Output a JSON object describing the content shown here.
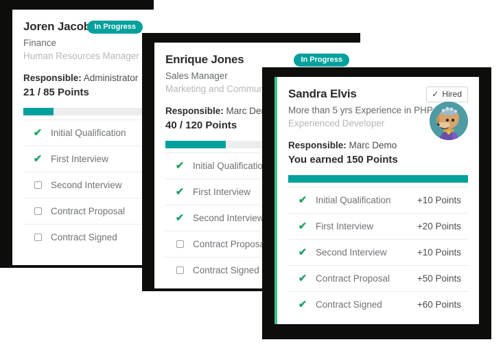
{
  "theme": {
    "teal": "#00a09d",
    "green_accent": "#41c08b",
    "check_green": "#21a366",
    "track": "#eceded",
    "text_dark": "#2b2b2b",
    "text_mid": "#64686b",
    "text_light": "#b4b7ba"
  },
  "cards": [
    {
      "id": "card-joren-jacob",
      "name": "Joren Jacob",
      "subtitle": "Finance",
      "tertiary": "Human Resources Manager",
      "responsible_label": "Responsible:",
      "responsible_name": "Administrator",
      "points": "21 / 85 Points",
      "badge": {
        "type": "in-progress",
        "label": "In Progress"
      },
      "progress_percent": 25,
      "has_avatar": false,
      "show_points_column": false,
      "stages": [
        {
          "label": "Initial Qualification",
          "checked": true,
          "points": ""
        },
        {
          "label": "First Interview",
          "checked": true,
          "points": ""
        },
        {
          "label": "Second Interview",
          "checked": false,
          "points": ""
        },
        {
          "label": "Contract Proposal",
          "checked": false,
          "points": ""
        },
        {
          "label": "Contract Signed",
          "checked": false,
          "points": ""
        }
      ]
    },
    {
      "id": "card-enrique-jones",
      "name": "Enrique Jones",
      "subtitle": "Sales Manager",
      "tertiary": "Marketing and Community",
      "responsible_label": "Responsible:",
      "responsible_name": "Marc Demo",
      "points": "40 / 120 Points",
      "badge": {
        "type": "in-progress",
        "label": "In Progress"
      },
      "progress_percent": 33,
      "has_avatar": false,
      "show_points_column": false,
      "stages": [
        {
          "label": "Initial Qualification",
          "checked": true,
          "points": ""
        },
        {
          "label": "First Interview",
          "checked": true,
          "points": ""
        },
        {
          "label": "Second Interview",
          "checked": true,
          "points": ""
        },
        {
          "label": "Contract Proposal",
          "checked": false,
          "points": ""
        },
        {
          "label": "Contract Signed",
          "checked": false,
          "points": ""
        }
      ]
    },
    {
      "id": "card-sandra-elvis",
      "name": "Sandra Elvis",
      "subtitle": "More than 5 yrs Experience in PHP",
      "tertiary": "Experienced Developer",
      "responsible_label": "Responsible:",
      "responsible_name": "Marc Demo",
      "points": "You earned 150 Points",
      "badge": {
        "type": "hired",
        "label": "Hired",
        "icon": "check-icon"
      },
      "progress_percent": 100,
      "has_avatar": true,
      "avatar_name": "dog-avatar",
      "show_points_column": true,
      "stages": [
        {
          "label": "Initial Qualification",
          "checked": true,
          "points": "+10 Points"
        },
        {
          "label": "First Interview",
          "checked": true,
          "points": "+20 Points"
        },
        {
          "label": "Second Interview",
          "checked": true,
          "points": "+10 Points"
        },
        {
          "label": "Contract Proposal",
          "checked": true,
          "points": "+50 Points"
        },
        {
          "label": "Contract Signed",
          "checked": true,
          "points": "+60 Points"
        }
      ]
    }
  ]
}
